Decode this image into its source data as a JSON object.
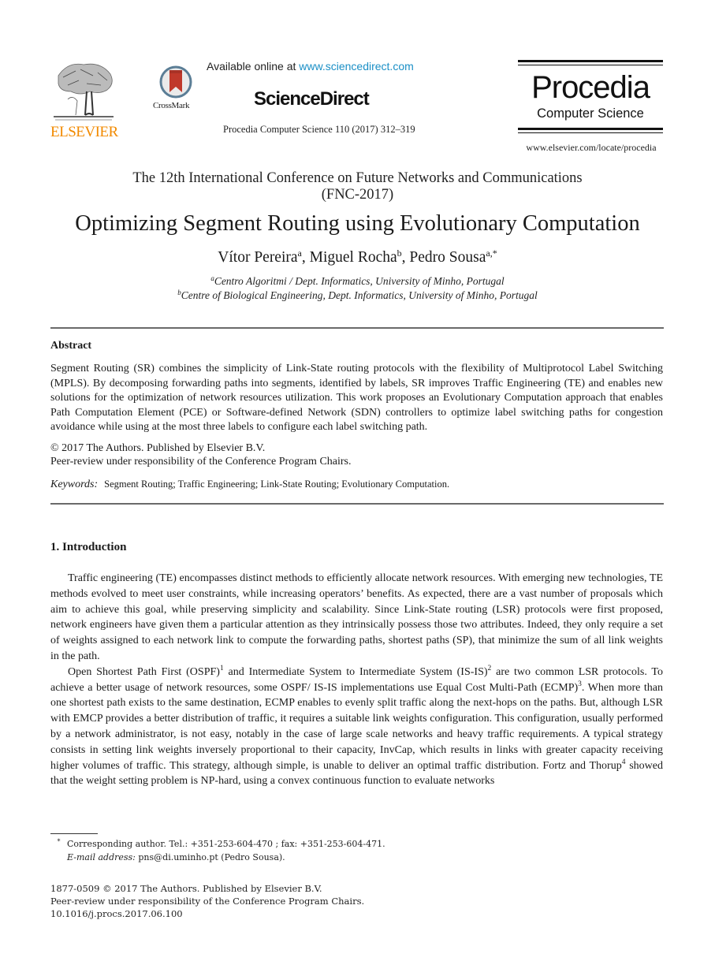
{
  "header": {
    "publisher_logo_text": "ELSEVIER",
    "crossmark_label": "CrossMark",
    "available_prefix": "Available online at ",
    "available_link": "www.sciencedirect.com",
    "sciencedirect_brand": "ScienceDirect",
    "journal_reference": "Procedia Computer Science 110 (2017) 312–319",
    "procedia_title": "Procedia",
    "procedia_subtitle": "Computer Science",
    "procedia_url": "www.elsevier.com/locate/procedia"
  },
  "conference": {
    "line1": "The 12th International Conference on Future Networks and Communications",
    "line2": "(FNC-2017)"
  },
  "paper": {
    "title": "Optimizing Segment Routing using Evolutionary Computation",
    "authors": [
      {
        "name": "Vítor Pereira",
        "sup": "a"
      },
      {
        "name": "Miguel Rocha",
        "sup": "b"
      },
      {
        "name": "Pedro Sousa",
        "sup": "a,*"
      }
    ],
    "affiliations": [
      {
        "sup": "a",
        "text": "Centro Algoritmi / Dept. Informatics, University of Minho, Portugal"
      },
      {
        "sup": "b",
        "text": "Centre of Biological Engineering, Dept. Informatics, University of Minho, Portugal"
      }
    ]
  },
  "abstract": {
    "heading": "Abstract",
    "body": "Segment Routing (SR) combines the simplicity of Link-State routing protocols with the flexibility of Multiprotocol Label Switching (MPLS). By decomposing forwarding paths into segments, identified by labels, SR improves Traffic Engineering (TE) and enables new solutions for the optimization of network resources utilization.  This work proposes an Evolutionary Computation approach that enables Path Computation Element (PCE) or Software-defined Network (SDN) controllers to optimize label switching paths for congestion avoidance while using at the most three labels to configure each label switching path.",
    "copyright_line1": "© 2017 The Authors. Published by Elsevier B.V.",
    "copyright_line2": "Peer-review under responsibility of the Conference Program Chairs.",
    "keywords_label": "Keywords:",
    "keywords": "Segment Routing; Traffic Engineering; Link-State Routing; Evolutionary Computation."
  },
  "introduction": {
    "heading": "1.  Introduction",
    "para1": "Traffic engineering (TE) encompasses distinct methods to efficiently allocate network resources.  With emerging new technologies, TE methods evolved to meet user constraints, while increasing operators’ benefits.  As expected, there are a vast number of proposals which aim to achieve this goal, while preserving simplicity and scalability. Since Link-State routing (LSR) protocols were first proposed, network engineers have given them a particular attention as they intrinsically possess those two attributes. Indeed, they only require a set of weights assigned to each network link to compute the forwarding paths, shortest paths (SP), that minimize the sum of all link weights in the path.",
    "para2": {
      "s1": "Open Shortest Path First (OSPF)",
      "ref1": "1",
      "s2": " and Intermediate System to Intermediate System (IS-IS)",
      "ref2": "2",
      "s3": " are two common LSR protocols. To achieve a better usage of network resources, some OSPF/ IS-IS implementations use Equal Cost Multi-Path (ECMP)",
      "ref3": "3",
      "s4": ". When more than one shortest path exists to the same destination, ECMP enables to evenly split traffic along the next-hops on the paths. But, although LSR with EMCP provides a better distribution of traffic, it requires a suitable link weights configuration.  This configuration, usually performed by a network administrator, is not easy, notably in the case of large scale networks and heavy traffic requirements.  A typical strategy consists in setting link weights inversely proportional to their capacity, InvCap, which results in links with greater capacity receiving higher volumes of traffic. This strategy, although simple, is unable to deliver an optimal traffic distribution. Fortz and Thorup",
      "ref4": "4",
      "s5": " showed that the weight setting problem is NP-hard, using a convex continuous function to evaluate networks"
    }
  },
  "footnotes": {
    "star": "*",
    "corresponding": "Corresponding author. Tel.: +351-253-604-470 ; fax: +351-253-604-471.",
    "email_label": "E-mail address:",
    "email_value": " pns@di.uminho.pt (Pedro Sousa)."
  },
  "footer": {
    "line1": "1877-0509 © 2017 The Authors. Published by Elsevier B.V.",
    "line2": "Peer-review under responsibility of the Conference Program Chairs.",
    "line3": "10.1016/j.procs.2017.06.100"
  },
  "colors": {
    "elsevier_orange": "#f28a00",
    "link_blue": "#1a8fc6",
    "crossmark_red": "#c0392b",
    "rule_gray": "#6a6a6a"
  }
}
